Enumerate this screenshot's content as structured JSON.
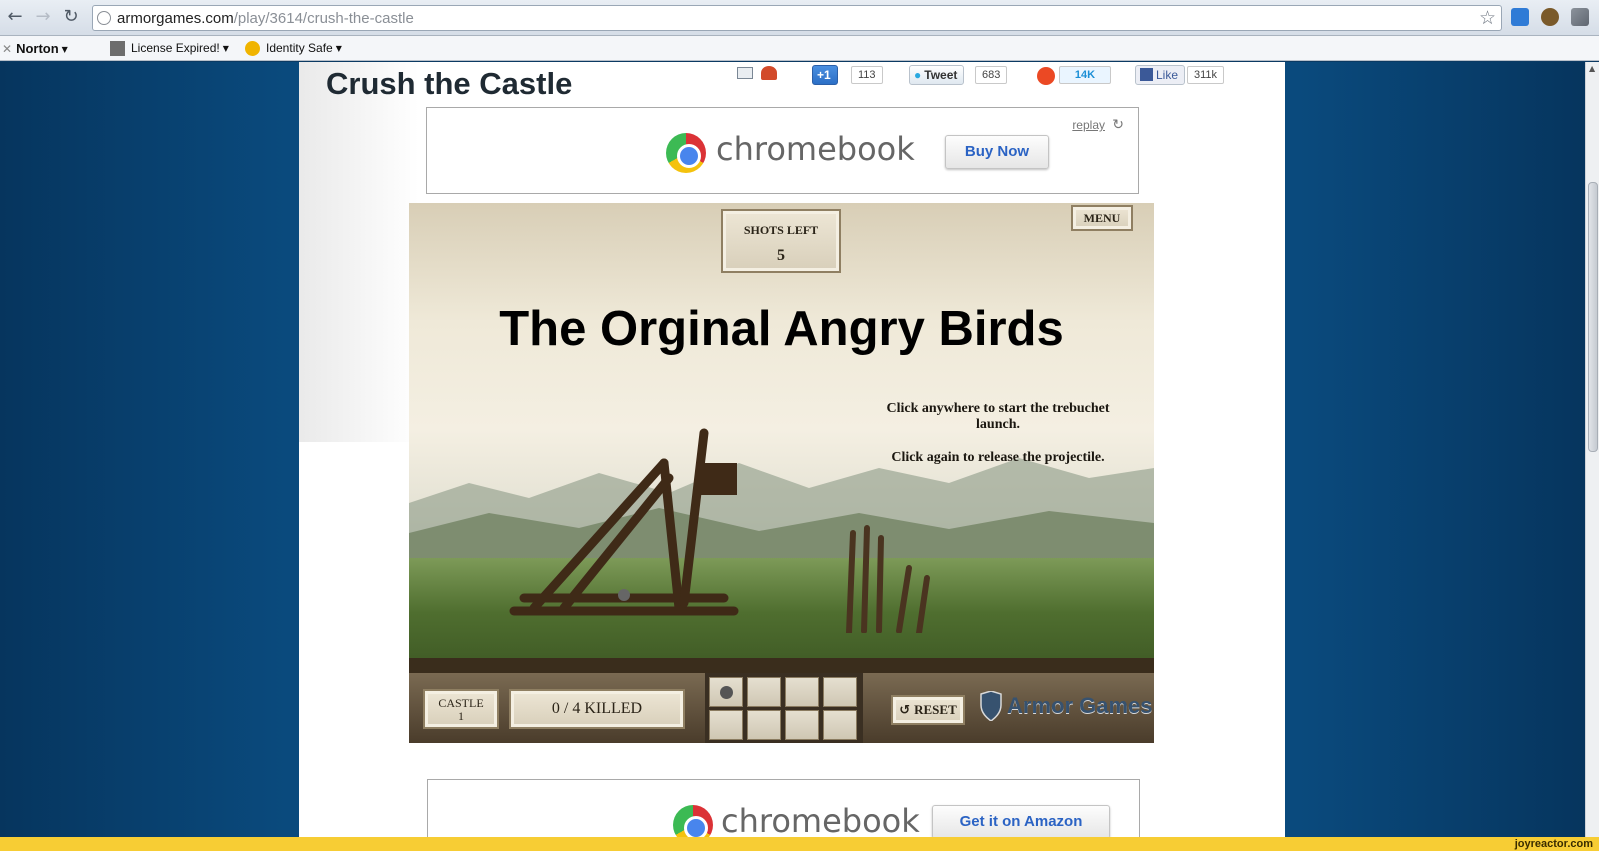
{
  "browser": {
    "url_host": "armorgames.com",
    "url_path": "/play/3614/crush-the-castle"
  },
  "bookmarks": {
    "norton": "Norton",
    "license": "License Expired!",
    "identity": "Identity Safe"
  },
  "page": {
    "title": "Crush the Castle",
    "share": {
      "gplus_label": "+1",
      "gplus_count": "113",
      "tweet_label": "Tweet",
      "tweet_count": "683",
      "stumble_count": "14K",
      "like_label": "Like",
      "like_count": "311k"
    },
    "ad_top": {
      "brand": "chromebook",
      "button": "Buy Now",
      "replay": "replay"
    },
    "ad_bottom": {
      "brand": "chromebook",
      "button": "Get it on Amazon"
    }
  },
  "game": {
    "shots_label": "SHOTS LEFT",
    "shots_value": "5",
    "menu": "MENU",
    "overlay_title": "The Orginal Angry Birds",
    "instruction_1": "Click anywhere to start the trebuchet launch.",
    "instruction_2": "Click again to release the projectile.",
    "castle_label": "CASTLE",
    "castle_value": "1",
    "killed": "0 /  4 KILLED",
    "reset": "RESET",
    "logo": "Armor Games"
  },
  "watermark": "joyreactor.com",
  "colors": {
    "page_bg": "#0a4a7d",
    "status_bar": "#f7cd34",
    "ad_button_text": "#2b63c4"
  }
}
